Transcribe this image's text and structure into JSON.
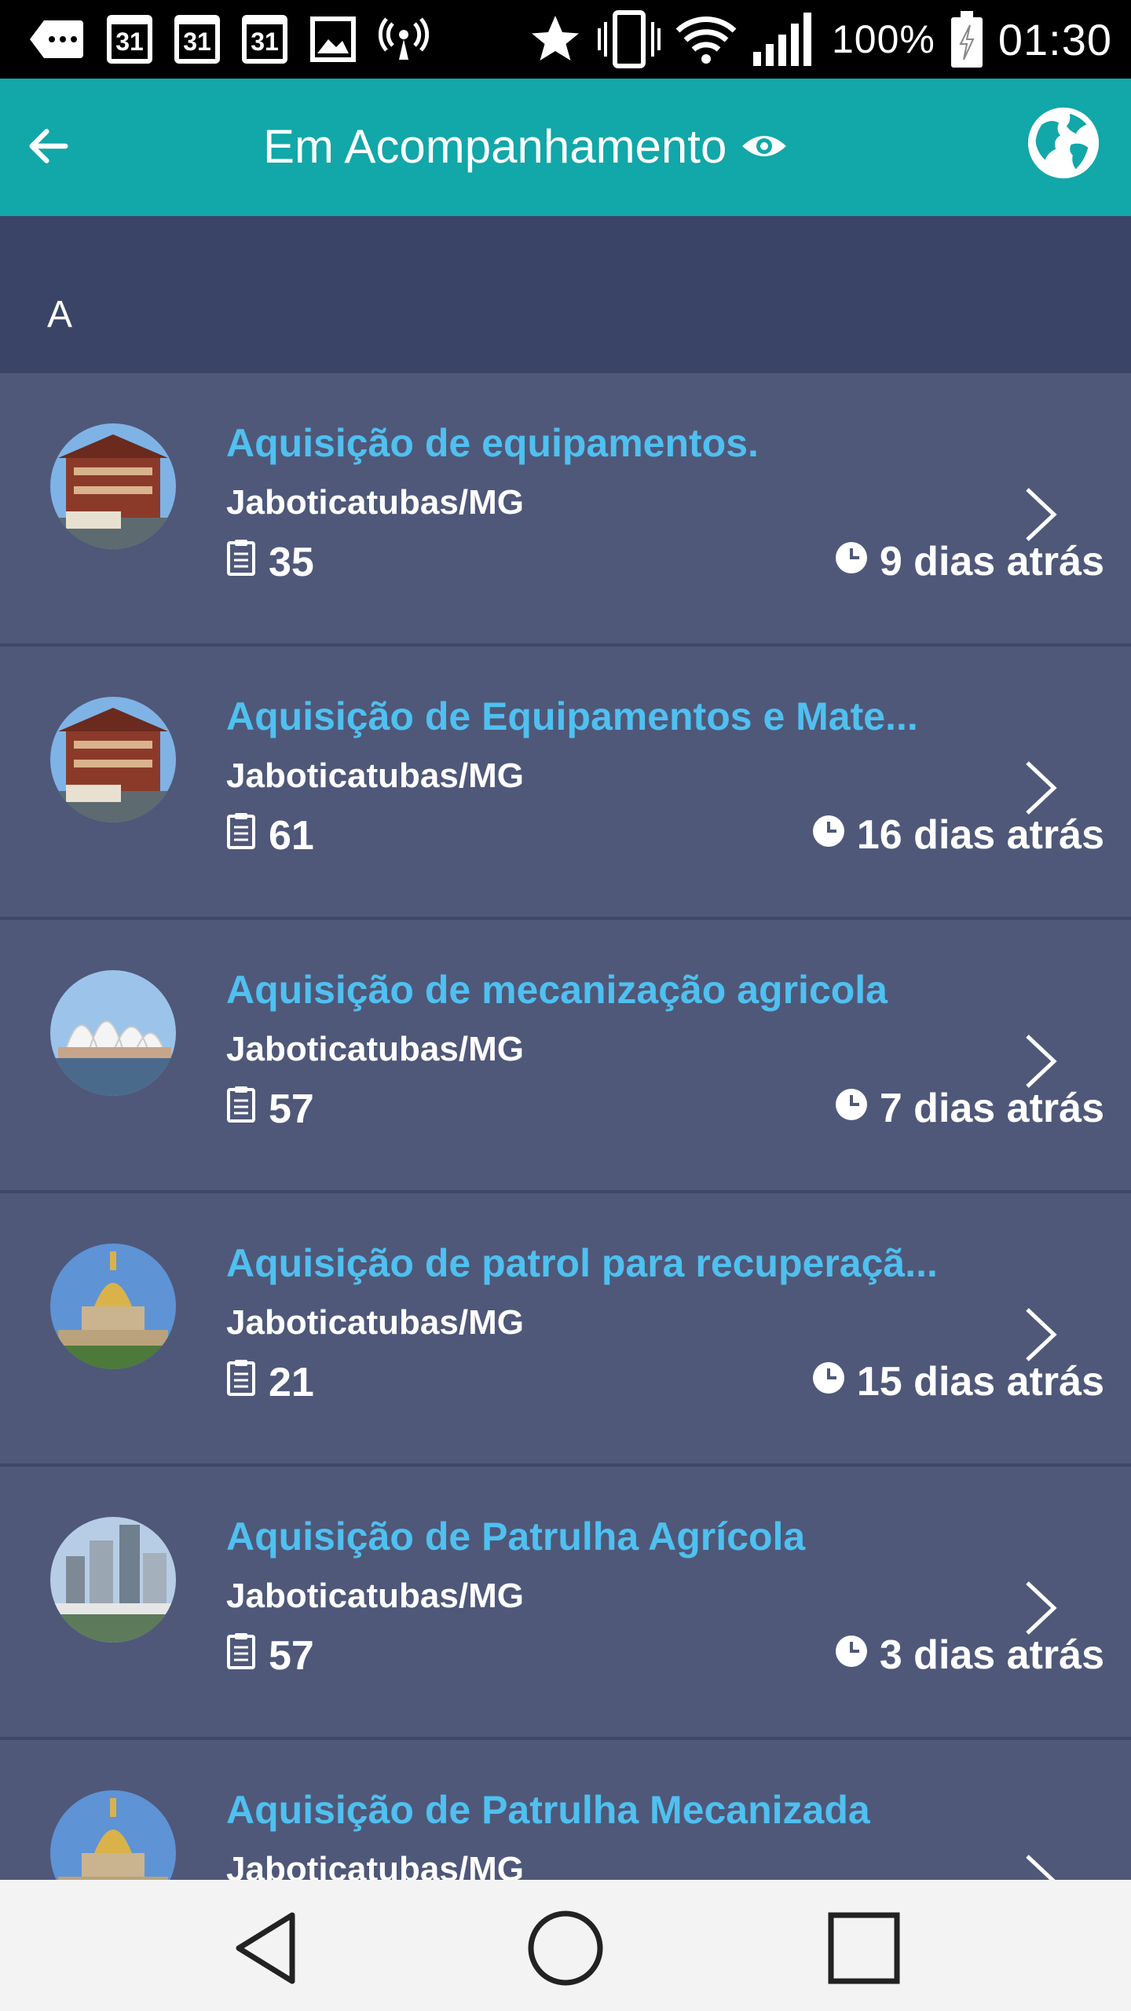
{
  "status_bar": {
    "calendar_day": "31",
    "battery": "100%",
    "time": "01:30",
    "icons": [
      "chat-icon",
      "calendar-icon",
      "calendar-icon",
      "calendar-icon",
      "image-icon",
      "hotspot-icon",
      "star-icon",
      "vibrate-icon",
      "wifi-icon",
      "signal-icon",
      "battery-icon"
    ]
  },
  "app_bar": {
    "title": "Em Acompanhamento",
    "back_icon": "arrow-left-icon",
    "title_icon": "eye-icon",
    "action_icon": "globe-icon"
  },
  "section": {
    "letter": "A"
  },
  "items": [
    {
      "title": "Aquisição de equipamentos.",
      "place": "Jaboticatubas/MG",
      "count": "35",
      "time": "9 dias atrás",
      "thumb": "pagoda-building"
    },
    {
      "title": "Aquisição de Equipamentos e Mate...",
      "place": "Jaboticatubas/MG",
      "count": "61",
      "time": "16 dias atrás",
      "thumb": "pagoda-building"
    },
    {
      "title": "Aquisição de mecanização agricola",
      "place": "Jaboticatubas/MG",
      "count": "57",
      "time": "7 dias atrás",
      "thumb": "opera-house"
    },
    {
      "title": "Aquisição de patrol para recuperaçã...",
      "place": "Jaboticatubas/MG",
      "count": "21",
      "time": "15 dias atrás",
      "thumb": "golden-dome"
    },
    {
      "title": "Aquisição de Patrulha Agrícola",
      "place": "Jaboticatubas/MG",
      "count": "57",
      "time": "3 dias atrás",
      "thumb": "city-skyline"
    },
    {
      "title": "Aquisição de Patrulha Mecanizada",
      "place": "Jaboticatubas/MG",
      "count": "",
      "time": "",
      "thumb": "golden-dome"
    }
  ],
  "colors": {
    "app_bar": "#12a7a8",
    "section_header": "#3a4466",
    "list_bg": "#4f5879",
    "title": "#4fc0f0"
  },
  "nav_bar": {
    "icons": [
      "back-triangle-icon",
      "home-circle-icon",
      "recents-square-icon"
    ]
  }
}
